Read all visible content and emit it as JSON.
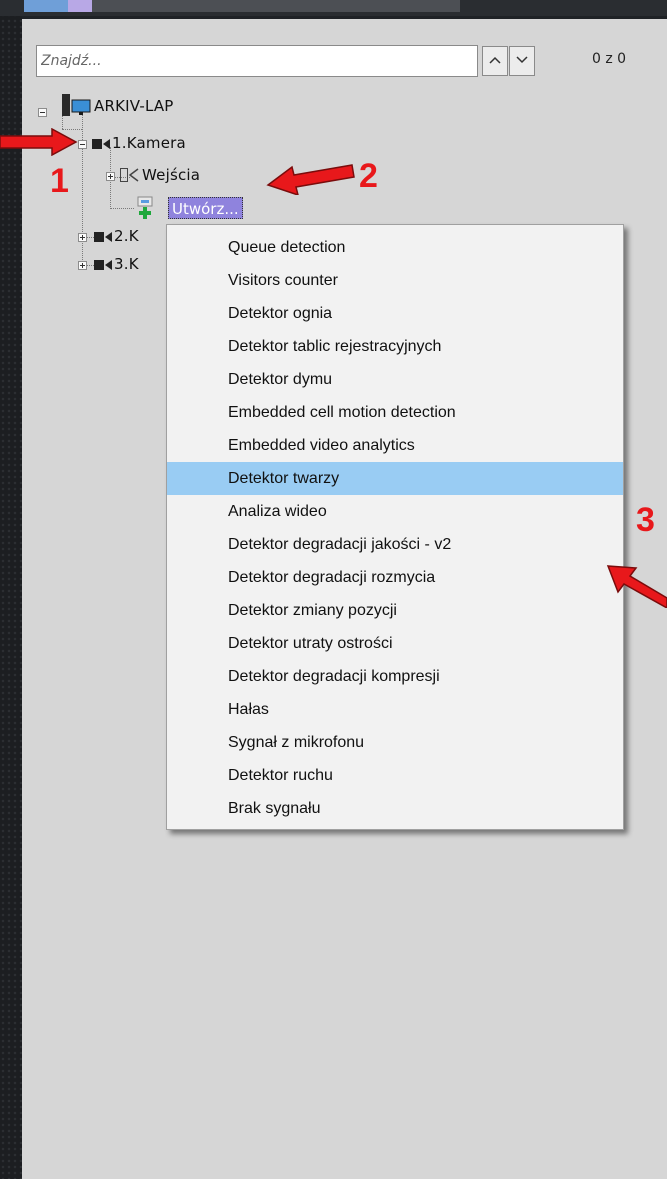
{
  "window": {
    "accent_color": "#6f9fd8",
    "tab_color": "#b8a8e6"
  },
  "search": {
    "placeholder": "Znajdź...",
    "value": ""
  },
  "nav": {
    "up_icon": "chevron-up-icon",
    "down_icon": "chevron-down-icon"
  },
  "counter": "0 z 0",
  "tree": {
    "root": {
      "label": "ARKIV-LAP",
      "icon": "computer-icon"
    },
    "camera1": {
      "label": "1.Kamera",
      "icon": "camera-icon"
    },
    "inputs": {
      "label": "Wejścia",
      "icon": "input-icon"
    },
    "create": {
      "label": "Utwórz...",
      "icon": "add-detector-icon"
    },
    "camera2": {
      "label": "2.K",
      "icon": "camera-icon"
    },
    "camera3": {
      "label": "3.K",
      "icon": "camera-icon"
    }
  },
  "menu": {
    "highlight_color": "#99ccf3",
    "items": [
      "Queue detection",
      "Visitors counter",
      "Detektor ognia",
      "Detektor tablic rejestracyjnych",
      "Detektor dymu",
      "Embedded cell motion detection",
      "Embedded video analytics",
      "Detektor twarzy",
      "Analiza wideo",
      "Detektor degradacji jakości - v2",
      "Detektor degradacji rozmycia",
      "Detektor zmiany pozycji",
      "Detektor utraty ostrości",
      "Detektor degradacji kompresji",
      "Hałas",
      "Sygnał z mikrofonu",
      "Detektor ruchu",
      "Brak sygnału"
    ],
    "highlighted_item": "Detektor twarzy"
  },
  "annotations": {
    "color": "#e8181b",
    "step1": "1",
    "step2": "2",
    "step3": "3"
  }
}
